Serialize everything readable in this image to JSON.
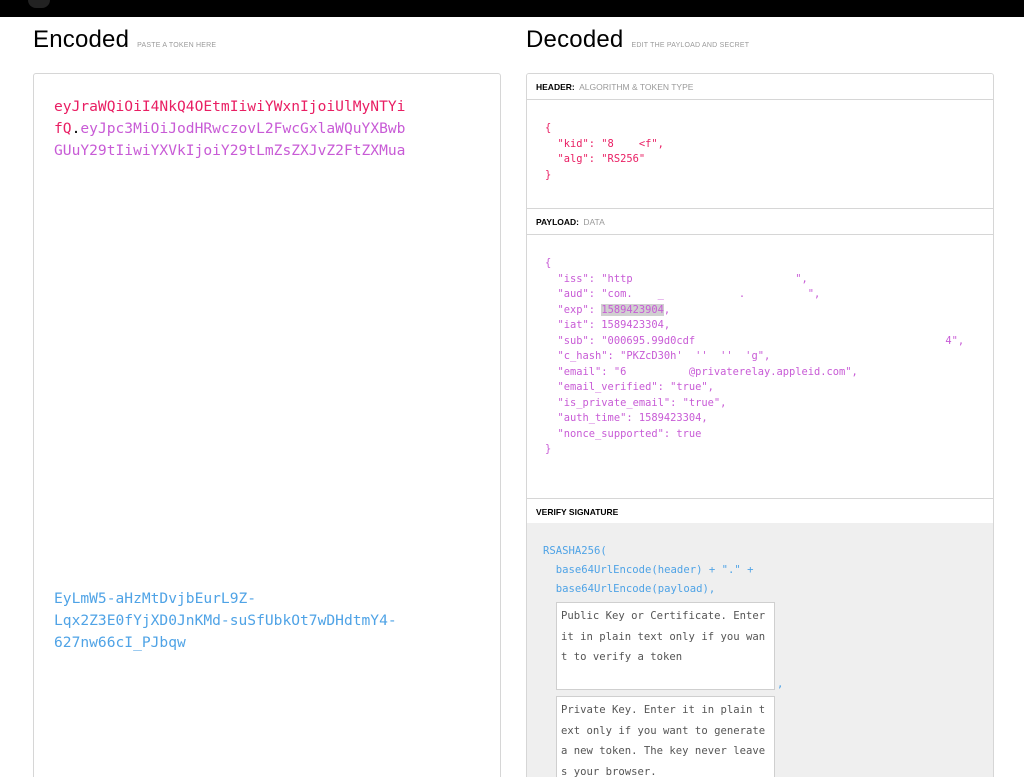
{
  "encoded": {
    "title": "Encoded",
    "hint": "PASTE A TOKEN HERE",
    "header_part": "eyJraWQiOiI4NkQ4OEtmIiwiYWxnIjoiUlMyNTYi\nfQ",
    "dot1": ".",
    "payload_part": "eyJpc3MiOiJodHRwczovL2FwcGxlaWQuYXBwb\nGUuY29tIiwiYXVkIjoiY29tLmZsZXJvZ2FtZXMua",
    "signature_part": "EyLmW5-aHzMtDvjbEurL9Z-\nLqx2Z3E0fYjXD0JnKMd-suSfUbkOt7wDHdtmY4-\n627nw66cI_PJbqw"
  },
  "decoded": {
    "title": "Decoded",
    "hint": "EDIT THE PAYLOAD AND SECRET",
    "header_section": {
      "label": "HEADER:",
      "sublabel": "ALGORITHM & TOKEN TYPE",
      "json": "{\n  \"kid\": \"8    <f\",\n  \"alg\": \"RS256\"\n}"
    },
    "payload_section": {
      "label": "PAYLOAD:",
      "sublabel": "DATA",
      "line_open": "{",
      "line_iss": "  \"iss\": \"http                          \",",
      "line_aud": "  \"aud\": \"com.    _            .          \",",
      "line_exp_key": "  \"exp\": ",
      "line_exp_value": "1589423904",
      "line_exp_tail": ",",
      "line_iat": "  \"iat\": 1589423304,",
      "line_sub": "  \"sub\": \"000695.99d0cdf                                        4\",",
      "line_chash": "  \"c_hash\": \"PKZcD30h'  ''  ''  'g\",",
      "line_email": "  \"email\": \"6          @privaterelay.appleid.com\",",
      "line_email_verified": "  \"email_verified\": \"true\",",
      "line_is_private": "  \"is_private_email\": \"true\",",
      "line_auth_time": "  \"auth_time\": 1589423304,",
      "line_nonce": "  \"nonce_supported\": true",
      "line_close": "}"
    },
    "signature_section": {
      "label": "VERIFY SIGNATURE",
      "line1": "RSASHA256(",
      "line2": "  base64UrlEncode(header) + \".\" +",
      "line3": "  base64UrlEncode(payload),",
      "public_key_placeholder": "Public Key or Certificate. Enter it in plain text only if you want to verify a token",
      "comma": ",",
      "private_key_placeholder": "Private Key. Enter it in plain text only if you want to generate a new token. The key never leaves your browser."
    }
  },
  "colors": {
    "header": "#e91e63",
    "payload": "#c85bd6",
    "signature": "#4fa3e6"
  }
}
